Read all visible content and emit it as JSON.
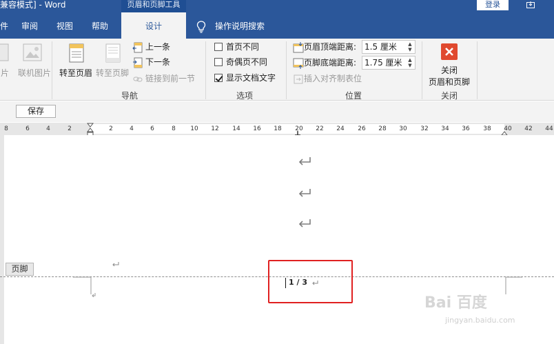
{
  "titlebar": {
    "title": "兼容模式] - Word",
    "contextual_tab_title": "页眉和页脚工具",
    "login_label": "登录"
  },
  "tabs": {
    "items": [
      {
        "label": "件"
      },
      {
        "label": "审阅"
      },
      {
        "label": "视图"
      },
      {
        "label": "帮助"
      },
      {
        "label": "设计"
      }
    ],
    "tell_me": "操作说明搜索"
  },
  "ribbon": {
    "insert_group": {
      "pictures_label": "片",
      "online_pictures_label": "联机图片"
    },
    "navigation": {
      "goto_header": "转至页眉",
      "goto_footer": "转至页脚",
      "previous": "上一条",
      "next": "下一条",
      "link_previous": "链接到前一节",
      "group_label": "导航"
    },
    "options": {
      "different_first_page": "首页不同",
      "different_odd_even": "奇偶页不同",
      "show_document_text": "显示文档文字",
      "group_label": "选项"
    },
    "position": {
      "header_from_top": "页眉顶端距离:",
      "header_from_top_value": "1.5 厘米",
      "footer_from_bottom": "页脚底端距离:",
      "footer_from_bottom_value": "1.75 厘米",
      "insert_alignment_tab": "插入对齐制表位",
      "group_label": "位置"
    },
    "close": {
      "close_line1": "关闭",
      "close_line2": "页眉和页脚",
      "group_label": "关闭"
    }
  },
  "quickbar": {
    "save_label": "保存"
  },
  "ruler": {
    "labels": [
      "8",
      "6",
      "4",
      "2",
      "2",
      "4",
      "6",
      "8",
      "10",
      "12",
      "14",
      "16",
      "18",
      "20",
      "22",
      "24",
      "26",
      "28",
      "30",
      "32",
      "34",
      "36",
      "38",
      "40",
      "42",
      "44"
    ]
  },
  "document": {
    "footer_tag": "页脚",
    "page_number_text": "1 / 3",
    "watermark": "Bai 百度",
    "watermark_sub": "jingyan.baidu.com"
  },
  "colors": {
    "title_blue": "#2b579a",
    "ribbon_bg": "#f3f3f3",
    "close_red": "#e0492f",
    "highlight_red": "#e02020"
  }
}
